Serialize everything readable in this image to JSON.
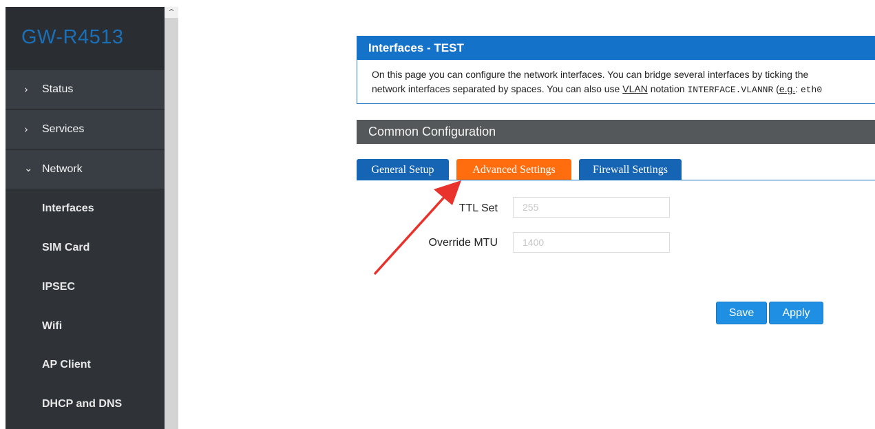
{
  "sidebar": {
    "brand": "GW-R4513",
    "sections": [
      {
        "label": "Status",
        "expanded": false
      },
      {
        "label": "Services",
        "expanded": false
      },
      {
        "label": "Network",
        "expanded": true
      }
    ],
    "network_items": [
      {
        "label": "Interfaces"
      },
      {
        "label": "SIM Card"
      },
      {
        "label": "IPSEC"
      },
      {
        "label": "Wifi"
      },
      {
        "label": "AP Client"
      },
      {
        "label": "DHCP and DNS"
      }
    ]
  },
  "scrollbar": {
    "up_glyph": "^"
  },
  "header": {
    "title": "Interfaces - TEST",
    "description_line1": "On this page you can configure the network interfaces. You can bridge several interfaces by ticking the",
    "description_line2_a": "network interfaces separated by spaces. You can also use ",
    "description_line2_vlan": "VLAN",
    "description_line2_b": " notation ",
    "description_line2_code": "INTERFACE.VLANNR",
    "description_line2_c": " (",
    "description_line2_eg": "e.g.",
    "description_line2_d": ": ",
    "description_line2_code2": "eth0"
  },
  "config": {
    "title": "Common Configuration",
    "tabs": [
      {
        "label": "General Setup",
        "active": false
      },
      {
        "label": "Advanced Settings",
        "active": true
      },
      {
        "label": "Firewall Settings",
        "active": false
      }
    ]
  },
  "form": {
    "ttl_label": "TTL Set",
    "ttl_placeholder": "255",
    "mtu_label": "Override MTU",
    "mtu_placeholder": "1400"
  },
  "actions": {
    "save_label": "Save",
    "apply_label": "Apply"
  },
  "colors": {
    "accent_blue": "#1572c9",
    "active_tab_orange": "#ff6d0e",
    "sidebar_bg": "#2f3338",
    "annotation_arrow": "#e8322b"
  }
}
